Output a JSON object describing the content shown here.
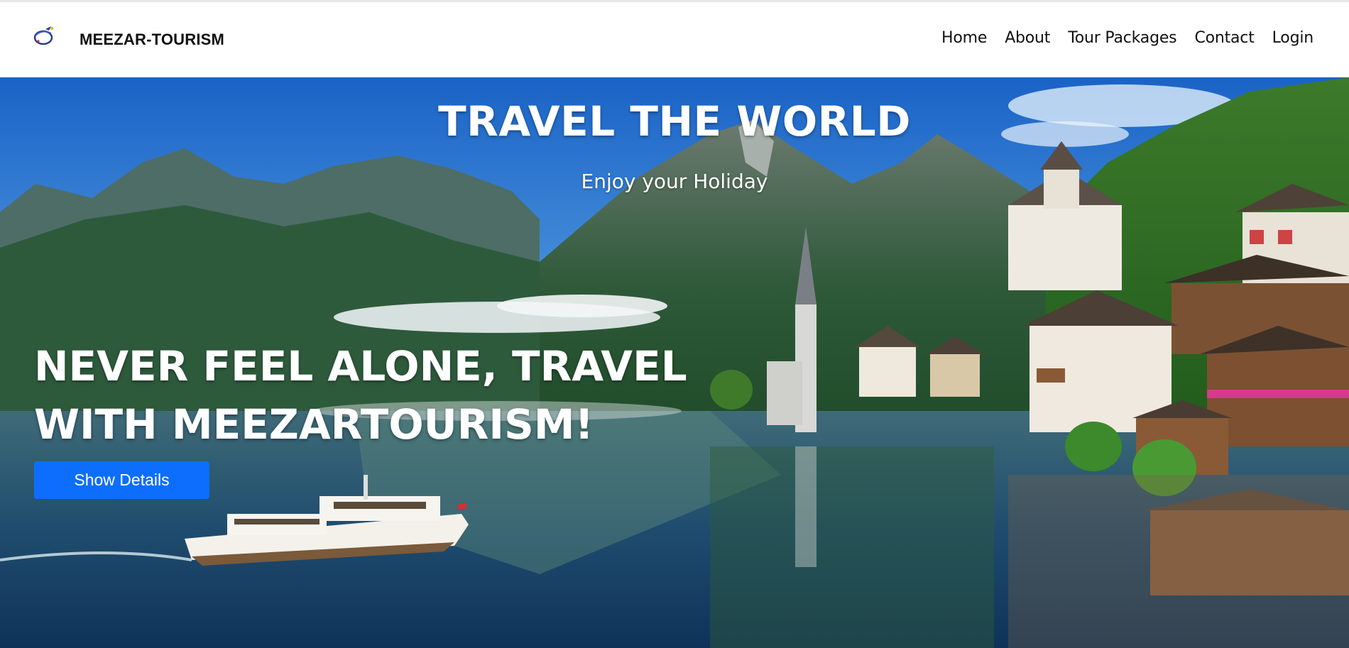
{
  "brand": {
    "name": "MEEZAR-TOURISM",
    "logo_icon": "globe-plane-icon"
  },
  "nav": {
    "items": [
      {
        "label": "Home"
      },
      {
        "label": "About"
      },
      {
        "label": "Tour Packages"
      },
      {
        "label": "Contact"
      },
      {
        "label": "Login"
      }
    ]
  },
  "hero": {
    "title": "TRAVEL THE WORLD",
    "subtitle": "Enjoy your Holiday",
    "headline": "NEVER FEEL ALONE, TRAVEL WITH MEEZARTOURISM!",
    "button_label": "Show Details",
    "button_color": "#0d6efd",
    "background_image": "lakeside alpine village with mountains and boat"
  }
}
